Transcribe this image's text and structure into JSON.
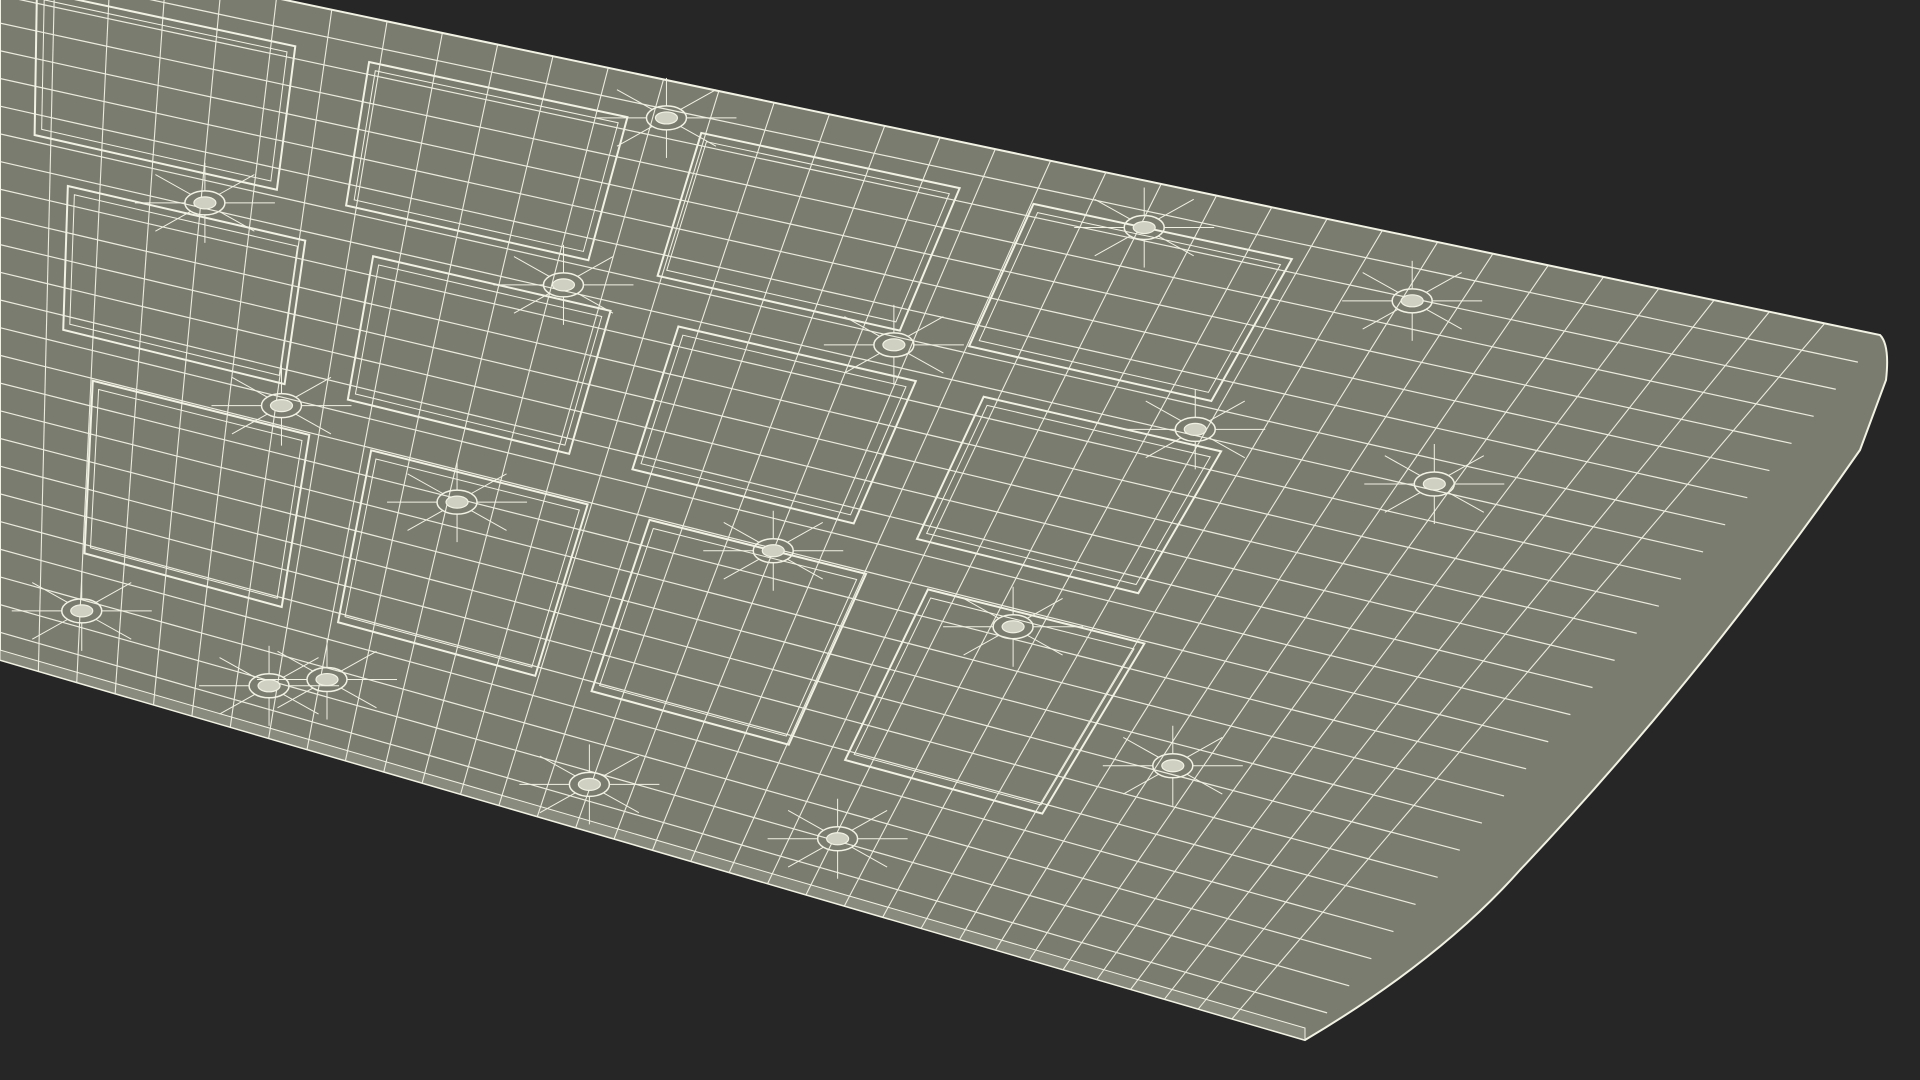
{
  "scene": {
    "background_color": "#262626",
    "surface_color": "#7b7c70",
    "wire_color": "#f2f2e4",
    "object": "wireframe-panel",
    "render_style": "wireframe-over-shaded"
  }
}
